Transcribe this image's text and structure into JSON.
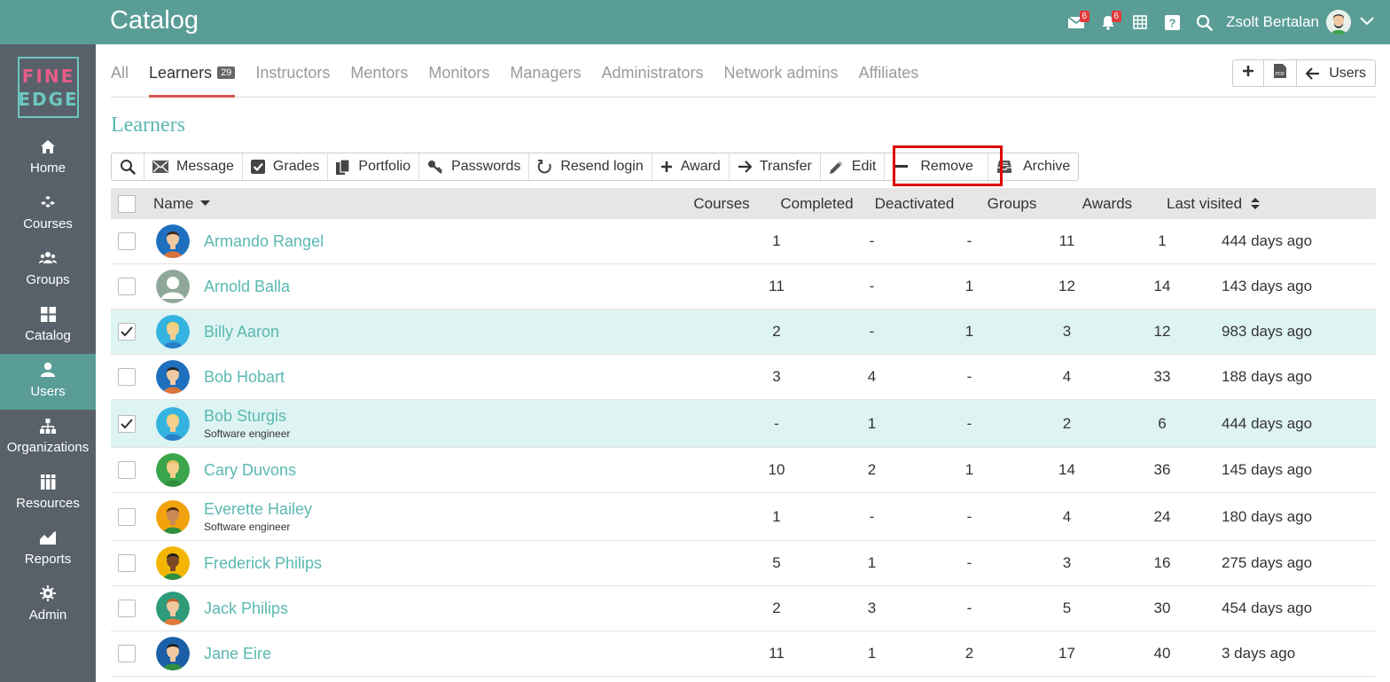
{
  "app": {
    "title": "Catalog",
    "user_name": "Zsolt Bertalan",
    "mail_badge": "6",
    "notif_badge": "6"
  },
  "logo": {
    "line1": "FINE",
    "line2": "EDGE"
  },
  "sidebar": {
    "items": [
      {
        "label": "Home",
        "icon": "home-icon"
      },
      {
        "label": "Courses",
        "icon": "courses-icon"
      },
      {
        "label": "Groups",
        "icon": "groups-icon"
      },
      {
        "label": "Catalog",
        "icon": "catalog-icon"
      },
      {
        "label": "Users",
        "icon": "user-icon",
        "active": true
      },
      {
        "label": "Organizations",
        "icon": "organizations-icon"
      },
      {
        "label": "Resources",
        "icon": "resources-icon"
      },
      {
        "label": "Reports",
        "icon": "reports-icon"
      },
      {
        "label": "Admin",
        "icon": "gear-icon"
      }
    ]
  },
  "tabs": [
    {
      "label": "All"
    },
    {
      "label": "Learners",
      "count": "29",
      "active": true
    },
    {
      "label": "Instructors"
    },
    {
      "label": "Mentors"
    },
    {
      "label": "Monitors"
    },
    {
      "label": "Managers"
    },
    {
      "label": "Administrators"
    },
    {
      "label": "Network admins"
    },
    {
      "label": "Affiliates"
    }
  ],
  "tab_actions": {
    "users_label": "Users"
  },
  "section_title": "Learners",
  "toolbar": {
    "message": "Message",
    "grades": "Grades",
    "portfolio": "Portfolio",
    "passwords": "Passwords",
    "resend": "Resend login",
    "award": "Award",
    "transfer": "Transfer",
    "edit": "Edit",
    "remove": "Remove",
    "archive": "Archive"
  },
  "table": {
    "headers": {
      "name": "Name",
      "courses": "Courses",
      "completed": "Completed",
      "deactivated": "Deactivated",
      "groups": "Groups",
      "awards": "Awards",
      "last_visited": "Last visited"
    },
    "rows": [
      {
        "name": "Armando Rangel",
        "sub": "",
        "courses": "1",
        "completed": "-",
        "deactivated": "-",
        "groups": "11",
        "awards": "1",
        "last": "444 days ago",
        "checked": false,
        "avatar_bg": "#1f6fbf",
        "skin": "#f1c9a0",
        "hair": "#3a2a1e",
        "shirt": "#d9733a"
      },
      {
        "name": "Arnold Balla",
        "sub": "",
        "courses": "11",
        "completed": "-",
        "deactivated": "1",
        "groups": "12",
        "awards": "14",
        "last": "143 days ago",
        "checked": false,
        "avatar_bg": "#8fa89a",
        "skin": "#ffffff",
        "hair": "#ffffff",
        "shirt": "#ffffff"
      },
      {
        "name": "Billy Aaron",
        "sub": "",
        "courses": "2",
        "completed": "-",
        "deactivated": "1",
        "groups": "3",
        "awards": "12",
        "last": "983 days ago",
        "checked": true,
        "avatar_bg": "#35b3e0",
        "skin": "#f4cf8e",
        "hair": "#f0d36a",
        "shirt": "#2a7fc9"
      },
      {
        "name": "Bob Hobart",
        "sub": "",
        "courses": "3",
        "completed": "4",
        "deactivated": "-",
        "groups": "4",
        "awards": "33",
        "last": "188 days ago",
        "checked": false,
        "avatar_bg": "#1f6fbf",
        "skin": "#f1c9a0",
        "hair": "#222222",
        "shirt": "#d9733a"
      },
      {
        "name": "Bob Sturgis",
        "sub": "Software engineer",
        "courses": "-",
        "completed": "1",
        "deactivated": "-",
        "groups": "2",
        "awards": "6",
        "last": "444 days ago",
        "checked": true,
        "avatar_bg": "#35b3e0",
        "skin": "#f4cf8e",
        "hair": "#f0d36a",
        "shirt": "#2a7fc9"
      },
      {
        "name": "Cary Duvons",
        "sub": "",
        "courses": "10",
        "completed": "2",
        "deactivated": "1",
        "groups": "14",
        "awards": "36",
        "last": "145 days ago",
        "checked": false,
        "avatar_bg": "#3aa54a",
        "skin": "#f4cf8e",
        "hair": "#e8c060",
        "shirt": "#2f8f3e"
      },
      {
        "name": "Everette Hailey",
        "sub": "Software engineer",
        "courses": "1",
        "completed": "-",
        "deactivated": "-",
        "groups": "4",
        "awards": "24",
        "last": "180 days ago",
        "checked": false,
        "avatar_bg": "#f2a20c",
        "skin": "#c98a55",
        "hair": "#4a2a12",
        "shirt": "#2f8f3e"
      },
      {
        "name": "Frederick Philips",
        "sub": "",
        "courses": "5",
        "completed": "1",
        "deactivated": "-",
        "groups": "3",
        "awards": "16",
        "last": "275 days ago",
        "checked": false,
        "avatar_bg": "#f2b600",
        "skin": "#7a4a25",
        "hair": "#1c1c1c",
        "shirt": "#2f8f3e"
      },
      {
        "name": "Jack Philips",
        "sub": "",
        "courses": "2",
        "completed": "3",
        "deactivated": "-",
        "groups": "5",
        "awards": "30",
        "last": "454 days ago",
        "checked": false,
        "avatar_bg": "#2e9b7a",
        "skin": "#f1c9a0",
        "hair": "#c0602a",
        "shirt": "#e07b39"
      },
      {
        "name": "Jane Eire",
        "sub": "",
        "courses": "11",
        "completed": "1",
        "deactivated": "2",
        "groups": "17",
        "awards": "40",
        "last": "3 days ago",
        "checked": false,
        "avatar_bg": "#1a5fa8",
        "skin": "#f1c9a0",
        "hair": "#1c1c1c",
        "shirt": "#2f8f3e"
      }
    ]
  }
}
